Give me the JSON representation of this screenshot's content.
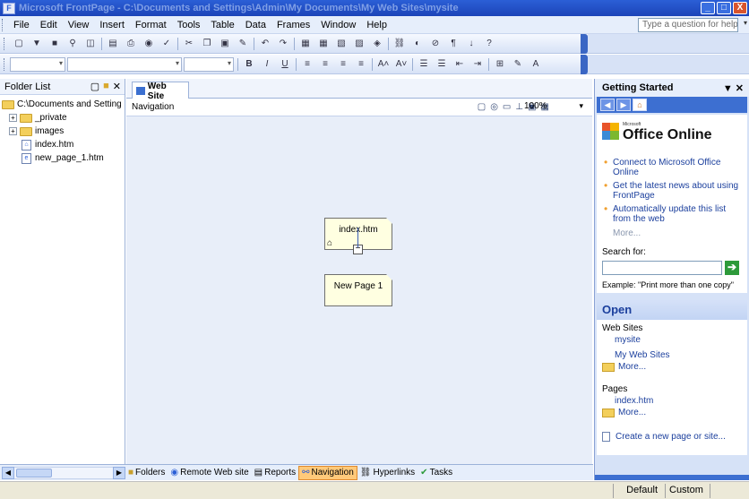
{
  "window": {
    "title": "Microsoft FrontPage - C:\\Documents and Settings\\Admin\\My Documents\\My Web Sites\\mysite",
    "controls": [
      "_",
      "□",
      "X"
    ]
  },
  "menu": {
    "items": [
      "File",
      "Edit",
      "View",
      "Insert",
      "Format",
      "Tools",
      "Table",
      "Data",
      "Frames",
      "Window",
      "Help"
    ],
    "help_placeholder": "Type a question for help"
  },
  "toolbar2": {
    "bold": "B",
    "italic": "I",
    "underline": "U"
  },
  "folder_list": {
    "title": "Folder List",
    "root": "C:\\Documents and Setting",
    "items": [
      {
        "name": "_private",
        "type": "folder",
        "expandable": true
      },
      {
        "name": "images",
        "type": "folder",
        "expandable": true
      },
      {
        "name": "index.htm",
        "type": "home-page"
      },
      {
        "name": "new_page_1.htm",
        "type": "page"
      }
    ]
  },
  "main": {
    "tab_label": "Web Site",
    "view_label": "Navigation",
    "zoom": "100%",
    "nodes": {
      "home": "index.htm",
      "child": "New Page 1"
    }
  },
  "view_bar": {
    "buttons": [
      {
        "label": "Folders",
        "icon": "folders-icon"
      },
      {
        "label": "Remote Web site",
        "icon": "remote-icon"
      },
      {
        "label": "Reports",
        "icon": "reports-icon"
      },
      {
        "label": "Navigation",
        "icon": "navigation-icon",
        "active": true
      },
      {
        "label": "Hyperlinks",
        "icon": "hyperlinks-icon"
      },
      {
        "label": "Tasks",
        "icon": "tasks-icon"
      }
    ]
  },
  "status": {
    "default": "Default",
    "custom": "Custom"
  },
  "task_pane": {
    "title": "Getting Started",
    "office_small": "Microsoft",
    "office_online": "Office Online",
    "links": [
      "Connect to Microsoft Office Online",
      "Get the latest news about using FrontPage",
      "Automatically update this list from the web"
    ],
    "more": "More...",
    "search_label": "Search for:",
    "example": "Example:  \"Print more than one copy\"",
    "open_title": "Open",
    "web_sites_label": "Web Sites",
    "web_sites": [
      "mysite",
      "My Web Sites"
    ],
    "web_more": "More...",
    "pages_label": "Pages",
    "pages": [
      "index.htm"
    ],
    "pages_more": "More...",
    "create": "Create a new page or site..."
  }
}
